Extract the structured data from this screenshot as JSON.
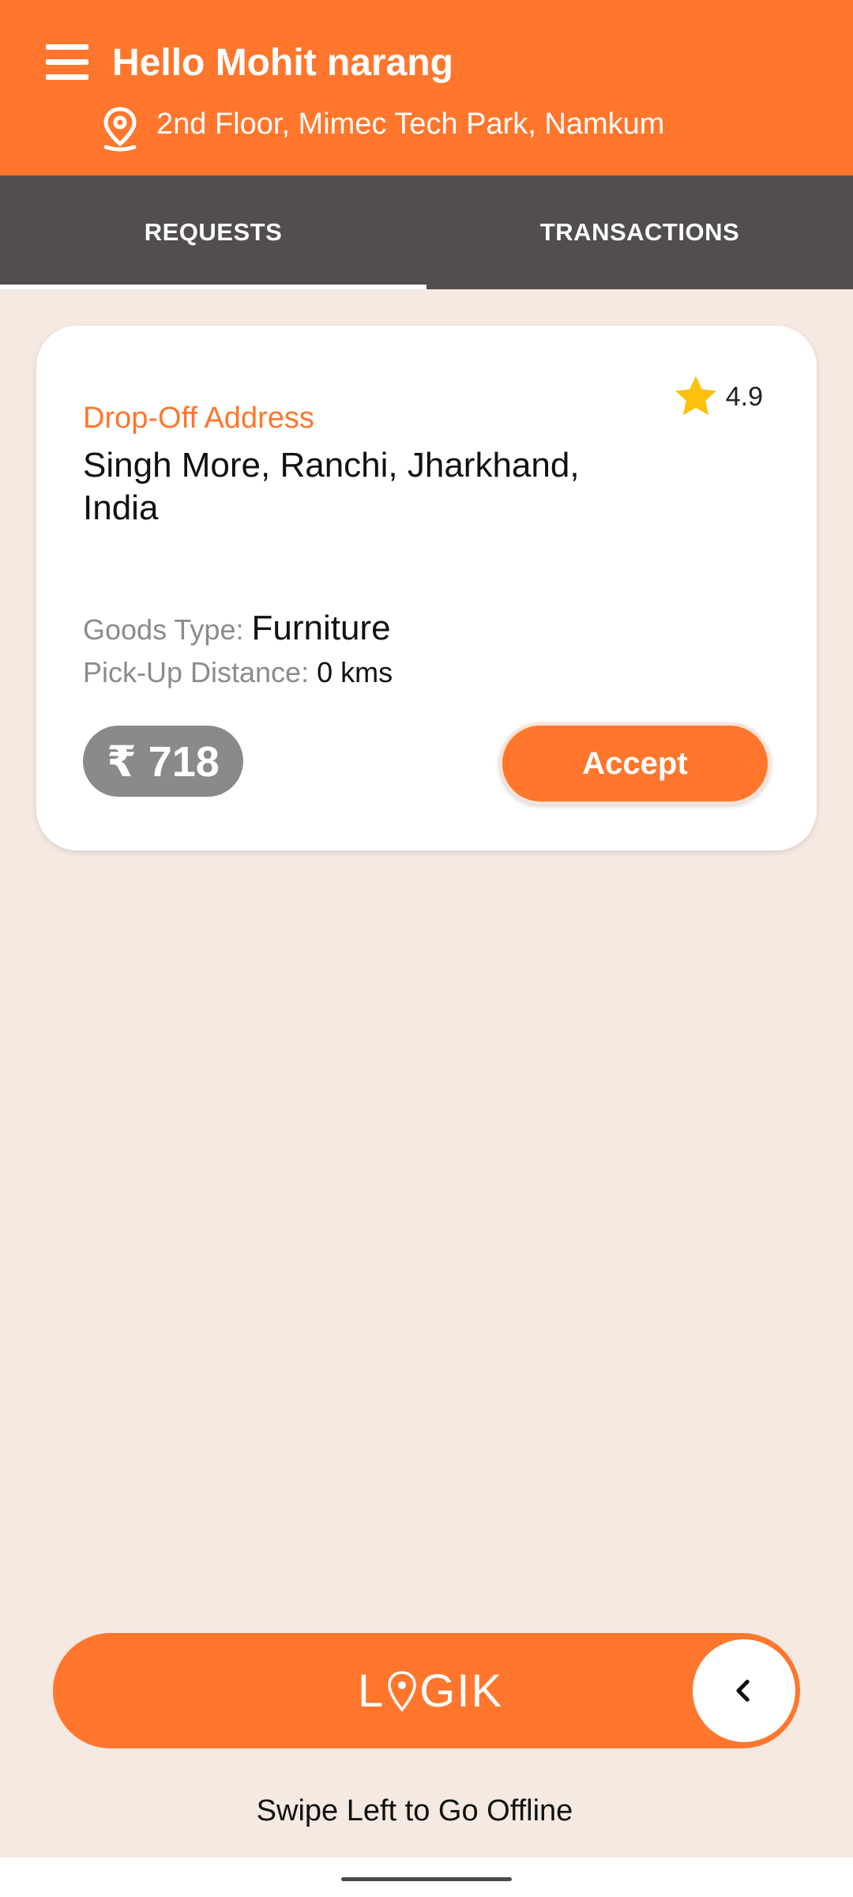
{
  "header": {
    "greeting": "Hello Mohit narang",
    "location": "2nd Floor, Mimec Tech Park, Namkum",
    "background_color": "#ff762c"
  },
  "tabs": [
    {
      "label": "REQUESTS",
      "active": true
    },
    {
      "label": "TRANSACTIONS",
      "active": false
    }
  ],
  "request_card": {
    "rating": "4.9",
    "drop_off_label": "Drop-Off Address",
    "drop_off_address": "Singh More, Ranchi, Jharkhand, India",
    "goods_type_label": "Goods Type:",
    "goods_type_value": "Furniture",
    "pickup_distance_label": "Pick-Up Distance:",
    "pickup_distance_value": "0 kms",
    "price": "₹ 718",
    "accept_label": "Accept"
  },
  "swipe": {
    "logo_text_left": "L",
    "logo_text_right": "GIK",
    "hint": "Swipe Left to Go Offline"
  },
  "icons": [
    "menu-icon",
    "location-pin-icon",
    "star-icon",
    "chevron-left-icon"
  ],
  "colors": {
    "accent": "#ff762c",
    "tab_bar": "#524e4d",
    "page_bg": "#f5e9e2",
    "star": "#fcc10d",
    "price_bg": "#8a8a8a"
  }
}
